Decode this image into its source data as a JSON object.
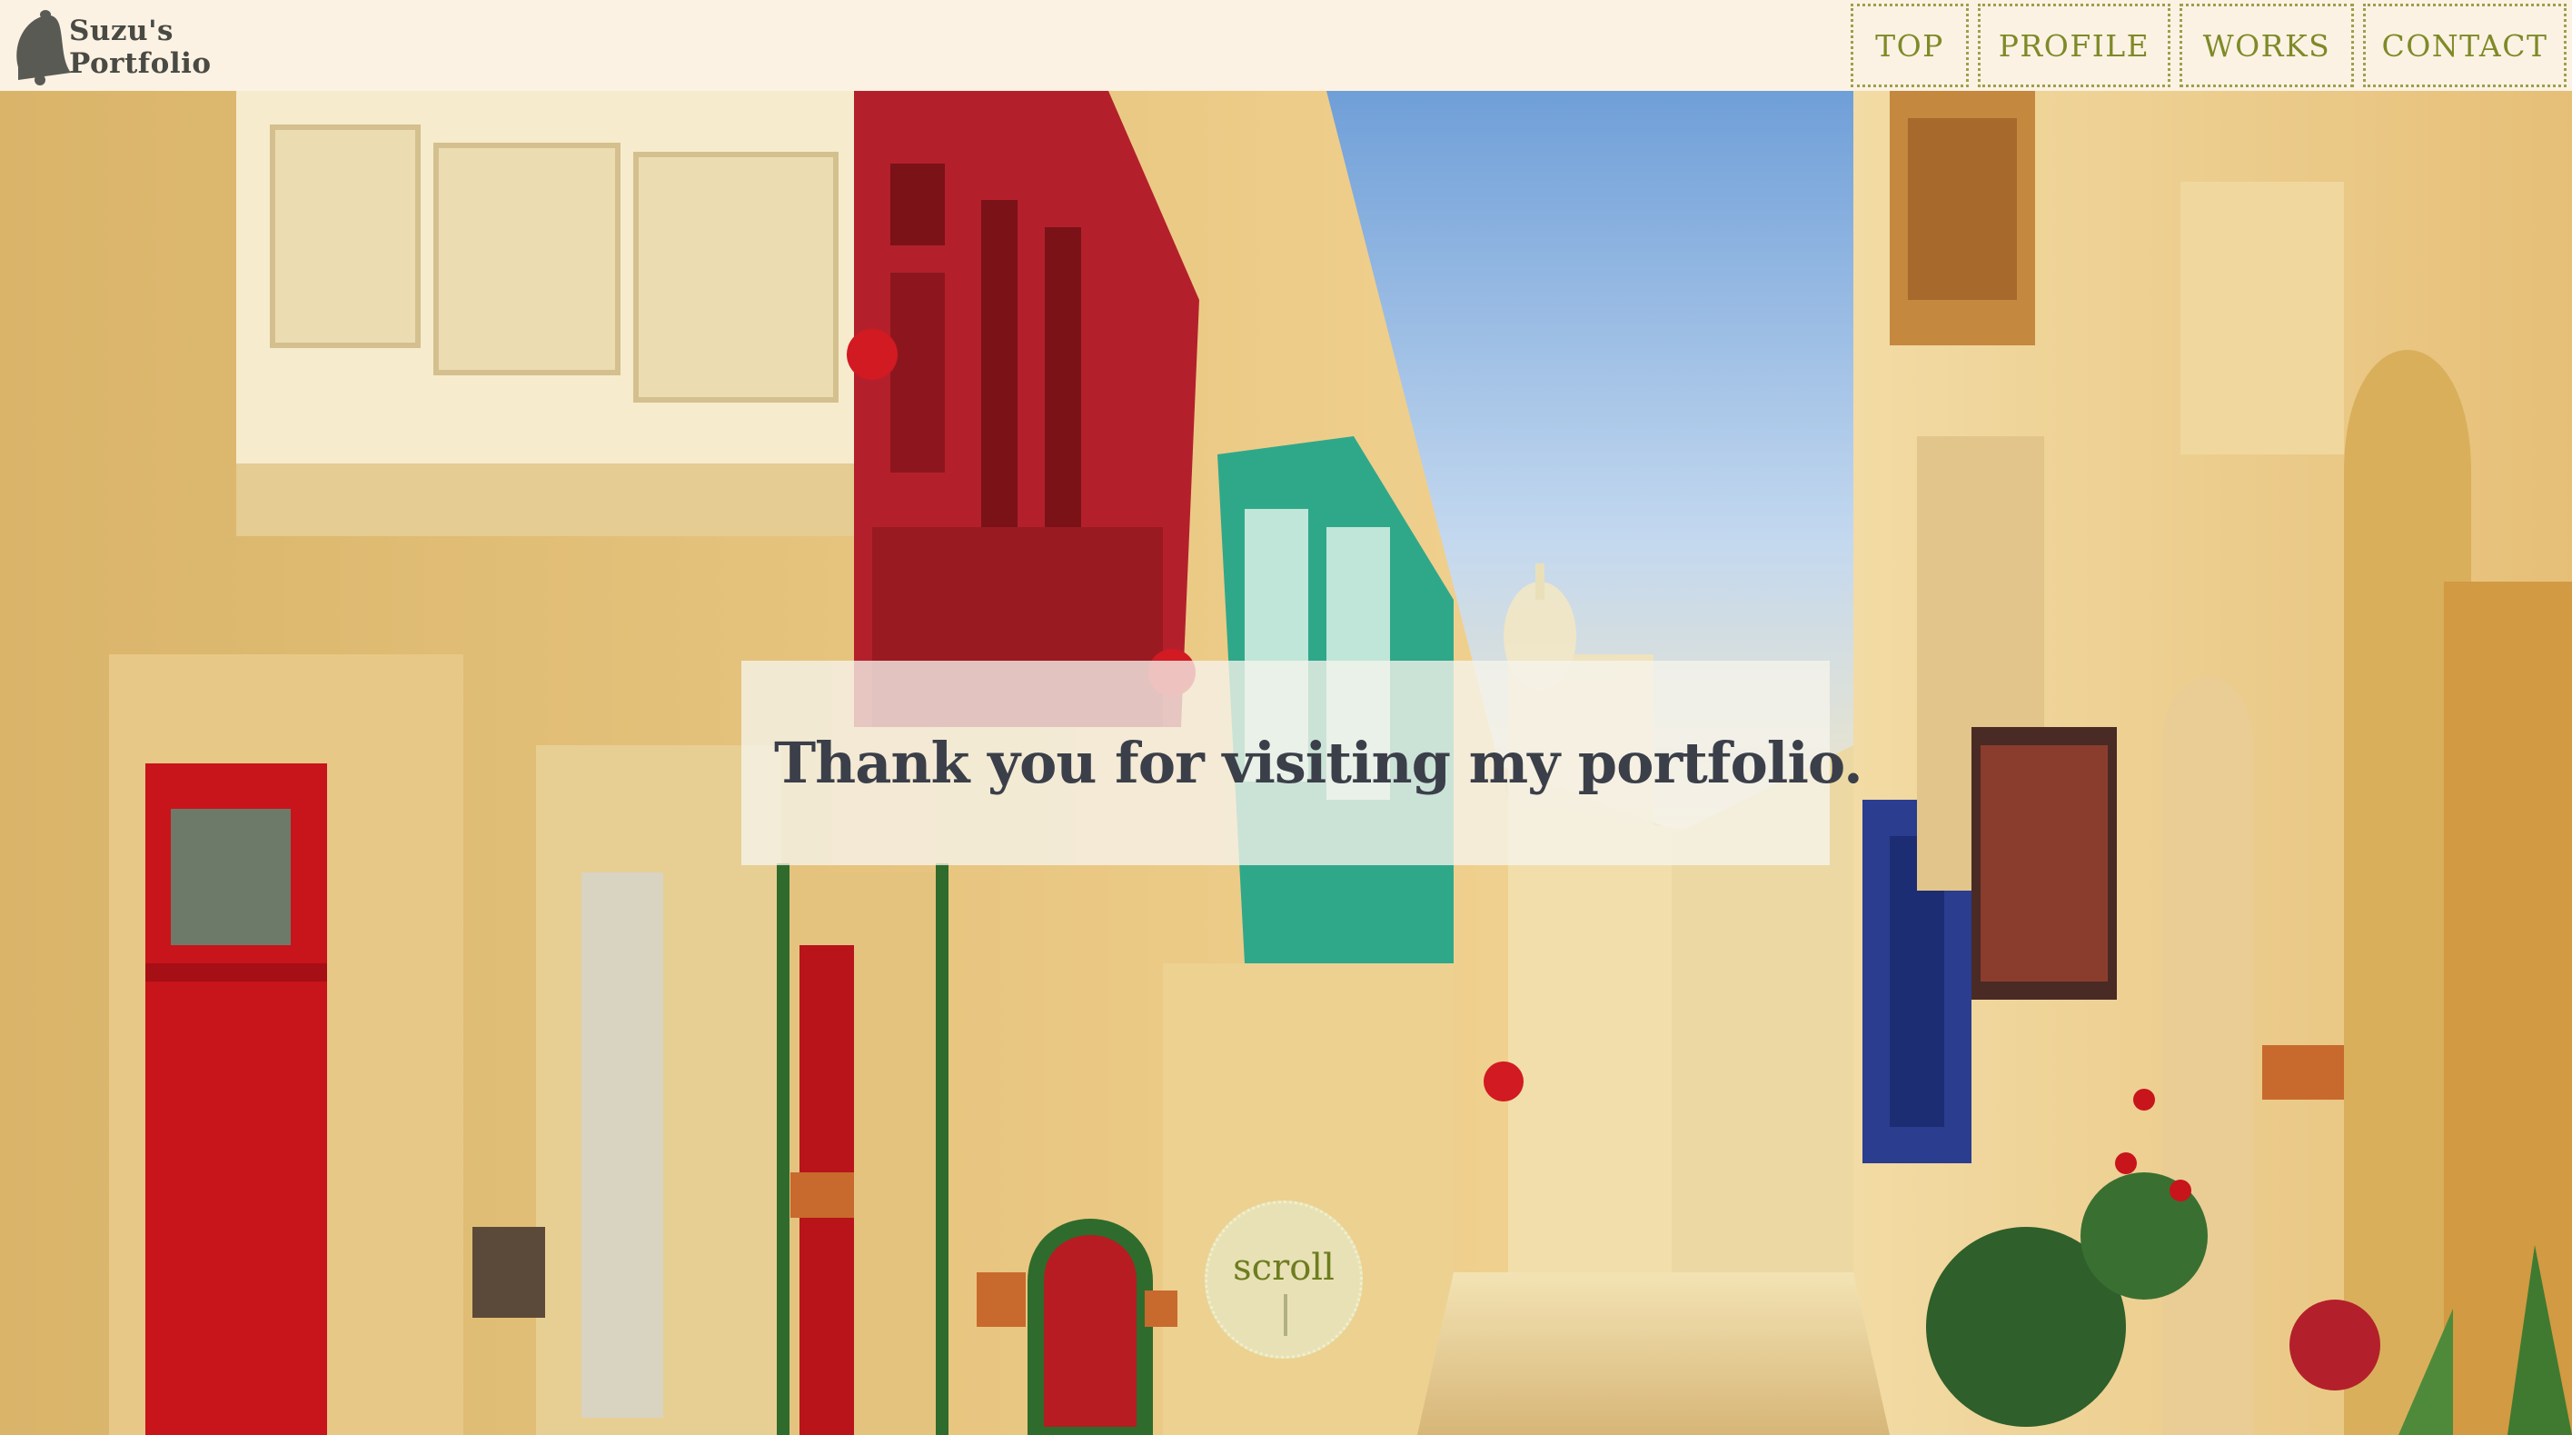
{
  "logo": {
    "line1": "Suzu's",
    "line2": "Portfolio"
  },
  "nav": {
    "top": "TOP",
    "profile": "PROFILE",
    "works": "WORKS",
    "contact": "CONTACT"
  },
  "hero": {
    "message": "Thank you for visiting my portfolio.",
    "scroll_label": "scroll"
  },
  "colors": {
    "header_bg": "#fcf2e3",
    "nav_text": "#7e8a28",
    "nav_border": "#9ca04c",
    "logo_text": "#4a4a44",
    "message_text": "#3b3f49",
    "scroll_text": "#6d7d1f"
  },
  "icons": {
    "logo": "bell-icon"
  }
}
